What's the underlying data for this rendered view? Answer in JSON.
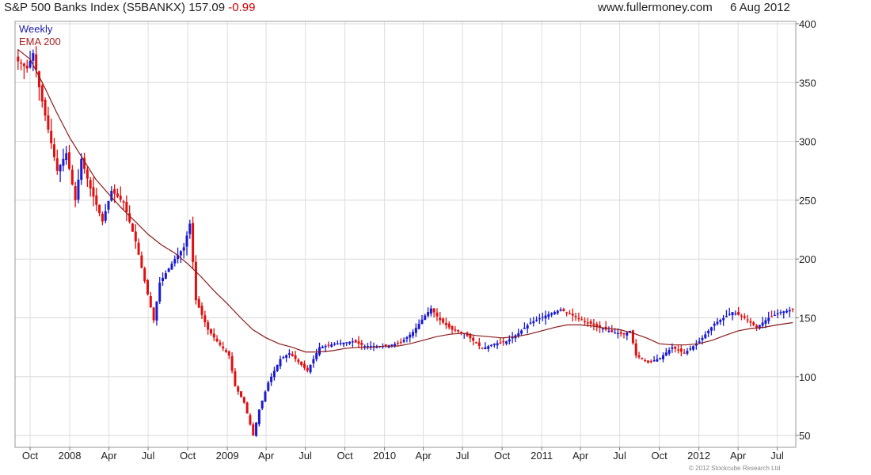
{
  "header": {
    "name": "S&P 500 Banks Index (S5BANKX)",
    "last": "157.09",
    "change": "-0.99",
    "site": "www.fullermoney.com",
    "date": "6 Aug 2012"
  },
  "legend": {
    "series1": "Weekly",
    "series2": "EMA 200"
  },
  "copyright": "© 2012 Stockcube Research Ltd",
  "chart_data": {
    "type": "candlestick",
    "frequency": "Weekly",
    "ylim": [
      40,
      402
    ],
    "ytick_values": [
      50,
      100,
      150,
      200,
      250,
      300,
      350,
      400
    ],
    "ytick_labels": [
      "50",
      "100",
      "150",
      "200",
      "250",
      "300",
      "350",
      "400"
    ],
    "xtick_labels": [
      "Oct",
      "2008",
      "Apr",
      "Jul",
      "Oct",
      "2009",
      "Apr",
      "Jul",
      "Oct",
      "2010",
      "Apr",
      "Jul",
      "Oct",
      "2011",
      "Apr",
      "Jul",
      "Oct",
      "2012",
      "Apr",
      "Jul"
    ],
    "xtick_dates": [
      "2007-10-01",
      "2008-01-01",
      "2008-04-01",
      "2008-07-01",
      "2008-10-01",
      "2009-01-01",
      "2009-04-01",
      "2009-07-01",
      "2009-10-01",
      "2010-01-01",
      "2010-04-01",
      "2010-07-01",
      "2010-10-01",
      "2011-01-01",
      "2011-04-01",
      "2011-07-01",
      "2011-10-01",
      "2012-01-01",
      "2012-04-01",
      "2012-07-01"
    ],
    "xlim": [
      "2007-08-27",
      "2012-08-13"
    ],
    "grid": true,
    "up_color": "#1a1ad0",
    "down_color": "#e01010",
    "series": [
      {
        "name": "Weekly",
        "close_anchors": [
          [
            "2007-09-03",
            368
          ],
          [
            "2007-09-24",
            362
          ],
          [
            "2007-10-08",
            375
          ],
          [
            "2007-10-22",
            346
          ],
          [
            "2007-11-12",
            310
          ],
          [
            "2007-12-03",
            275
          ],
          [
            "2007-12-24",
            290
          ],
          [
            "2008-01-14",
            250
          ],
          [
            "2008-01-28",
            285
          ],
          [
            "2008-02-18",
            260
          ],
          [
            "2008-03-17",
            232
          ],
          [
            "2008-04-07",
            258
          ],
          [
            "2008-05-05",
            248
          ],
          [
            "2008-06-02",
            215
          ],
          [
            "2008-06-30",
            170
          ],
          [
            "2008-07-14",
            148
          ],
          [
            "2008-07-28",
            180
          ],
          [
            "2008-09-01",
            200
          ],
          [
            "2008-09-22",
            210
          ],
          [
            "2008-10-06",
            230
          ],
          [
            "2008-10-20",
            165
          ],
          [
            "2008-11-17",
            140
          ],
          [
            "2008-12-08",
            130
          ],
          [
            "2009-01-05",
            118
          ],
          [
            "2009-01-19",
            92
          ],
          [
            "2009-02-09",
            78
          ],
          [
            "2009-03-02",
            50
          ],
          [
            "2009-03-16",
            72
          ],
          [
            "2009-04-06",
            95
          ],
          [
            "2009-05-04",
            115
          ],
          [
            "2009-05-25",
            120
          ],
          [
            "2009-07-06",
            105
          ],
          [
            "2009-08-03",
            125
          ],
          [
            "2009-09-07",
            128
          ],
          [
            "2009-10-19",
            130
          ],
          [
            "2009-11-16",
            126
          ],
          [
            "2010-01-04",
            126
          ],
          [
            "2010-02-08",
            129
          ],
          [
            "2010-03-08",
            138
          ],
          [
            "2010-04-05",
            152
          ],
          [
            "2010-04-19",
            158
          ],
          [
            "2010-05-10",
            148
          ],
          [
            "2010-06-07",
            140
          ],
          [
            "2010-07-05",
            137
          ],
          [
            "2010-08-16",
            124
          ],
          [
            "2010-09-13",
            128
          ],
          [
            "2010-10-11",
            130
          ],
          [
            "2010-11-08",
            137
          ],
          [
            "2010-12-06",
            146
          ],
          [
            "2011-01-10",
            152
          ],
          [
            "2011-02-14",
            157
          ],
          [
            "2011-03-14",
            152
          ],
          [
            "2011-04-11",
            147
          ],
          [
            "2011-05-09",
            143
          ],
          [
            "2011-06-13",
            138
          ],
          [
            "2011-07-11",
            136
          ],
          [
            "2011-07-25",
            139
          ],
          [
            "2011-08-08",
            118
          ],
          [
            "2011-09-05",
            112
          ],
          [
            "2011-10-03",
            116
          ],
          [
            "2011-10-31",
            125
          ],
          [
            "2011-11-28",
            120
          ],
          [
            "2012-01-02",
            130
          ],
          [
            "2012-02-06",
            145
          ],
          [
            "2012-03-19",
            155
          ],
          [
            "2012-04-16",
            150
          ],
          [
            "2012-05-14",
            142
          ],
          [
            "2012-06-11",
            150
          ],
          [
            "2012-07-09",
            155
          ],
          [
            "2012-08-06",
            157.09
          ]
        ]
      },
      {
        "name": "EMA 200",
        "color": "#8b1a1a",
        "points": [
          [
            "2007-09-03",
            378
          ],
          [
            "2007-10-01",
            370
          ],
          [
            "2007-11-01",
            348
          ],
          [
            "2007-12-01",
            325
          ],
          [
            "2008-01-01",
            303
          ],
          [
            "2008-02-01",
            285
          ],
          [
            "2008-03-01",
            268
          ],
          [
            "2008-04-01",
            255
          ],
          [
            "2008-05-01",
            243
          ],
          [
            "2008-06-01",
            232
          ],
          [
            "2008-07-01",
            221
          ],
          [
            "2008-08-01",
            212
          ],
          [
            "2008-09-01",
            205
          ],
          [
            "2008-10-01",
            196
          ],
          [
            "2008-11-01",
            185
          ],
          [
            "2008-12-01",
            173
          ],
          [
            "2009-01-01",
            162
          ],
          [
            "2009-02-01",
            150
          ],
          [
            "2009-03-01",
            140
          ],
          [
            "2009-04-01",
            133
          ],
          [
            "2009-05-01",
            128
          ],
          [
            "2009-06-01",
            125
          ],
          [
            "2009-07-01",
            121
          ],
          [
            "2009-08-01",
            121
          ],
          [
            "2009-09-01",
            122
          ],
          [
            "2009-10-01",
            124
          ],
          [
            "2009-11-01",
            125
          ],
          [
            "2009-12-01",
            125
          ],
          [
            "2010-01-01",
            126
          ],
          [
            "2010-02-01",
            126
          ],
          [
            "2010-03-01",
            128
          ],
          [
            "2010-04-01",
            131
          ],
          [
            "2010-05-01",
            134
          ],
          [
            "2010-06-01",
            136
          ],
          [
            "2010-07-01",
            137
          ],
          [
            "2010-08-01",
            135
          ],
          [
            "2010-09-01",
            134
          ],
          [
            "2010-10-01",
            133
          ],
          [
            "2010-11-01",
            134
          ],
          [
            "2010-12-01",
            136
          ],
          [
            "2011-01-01",
            139
          ],
          [
            "2011-02-01",
            142
          ],
          [
            "2011-03-01",
            144
          ],
          [
            "2011-04-01",
            144
          ],
          [
            "2011-05-01",
            143
          ],
          [
            "2011-06-01",
            141
          ],
          [
            "2011-07-01",
            140
          ],
          [
            "2011-08-01",
            137
          ],
          [
            "2011-09-01",
            133
          ],
          [
            "2011-10-01",
            128
          ],
          [
            "2011-11-01",
            127
          ],
          [
            "2011-12-01",
            127
          ],
          [
            "2012-01-01",
            128
          ],
          [
            "2012-02-01",
            131
          ],
          [
            "2012-03-01",
            135
          ],
          [
            "2012-04-01",
            139
          ],
          [
            "2012-05-01",
            141
          ],
          [
            "2012-06-01",
            142
          ],
          [
            "2012-07-01",
            144
          ],
          [
            "2012-08-06",
            146
          ]
        ]
      }
    ]
  }
}
